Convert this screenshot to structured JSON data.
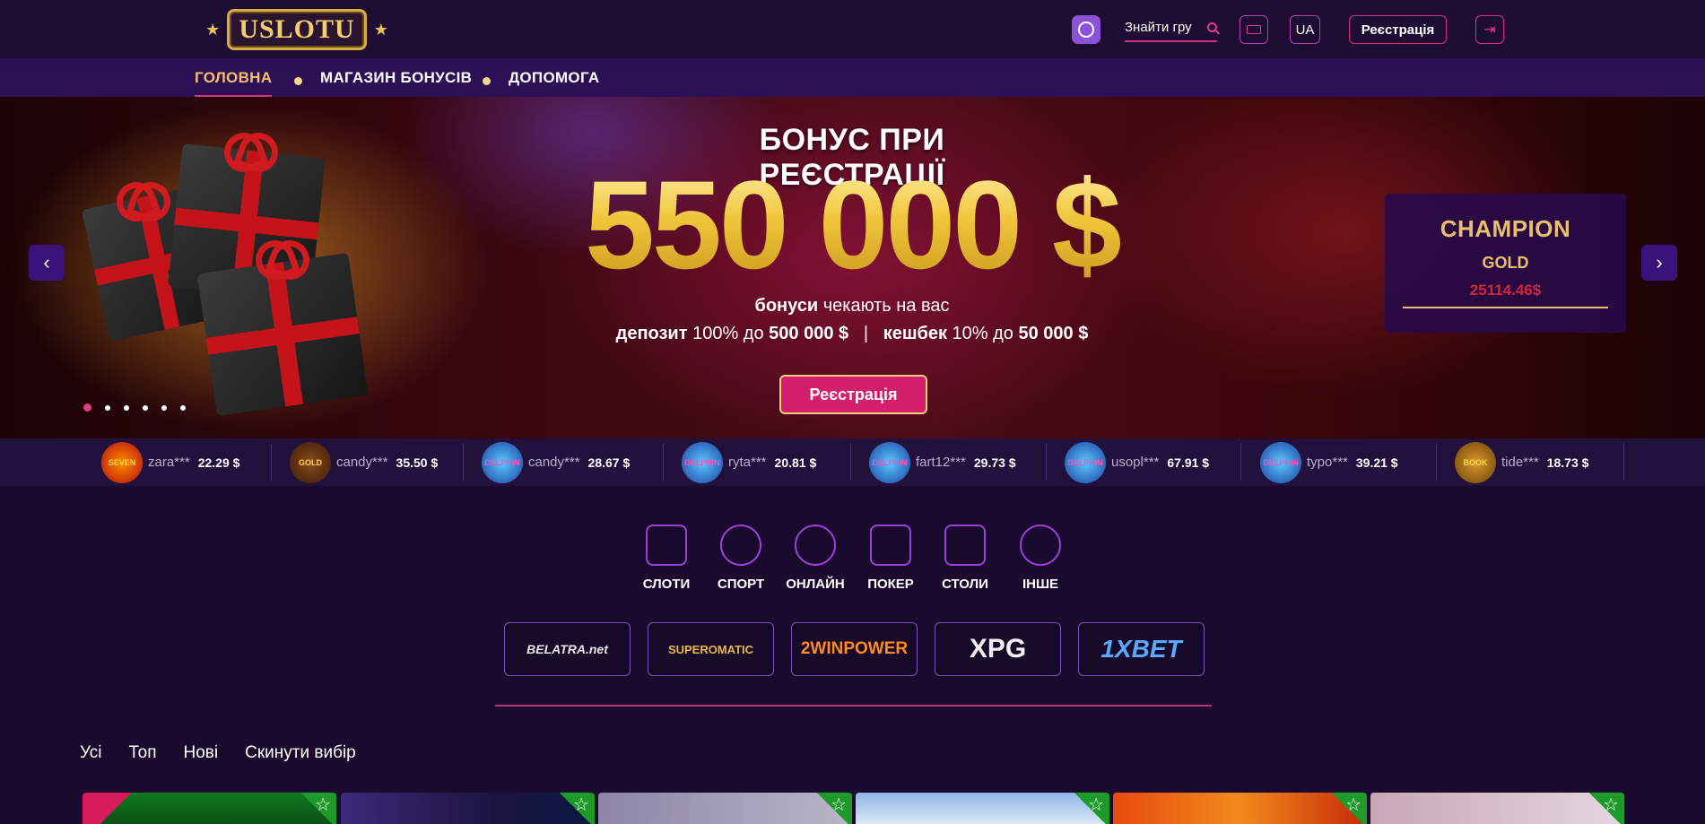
{
  "header": {
    "logo_text": "SLOT",
    "search_label": "Знайти гру",
    "lang": "UA",
    "register_label": "Реєстрація"
  },
  "nav": {
    "items": [
      "ГОЛОВНА",
      "МАГАЗИН БОНУСІВ",
      "ДОПОМОГА"
    ]
  },
  "hero": {
    "title": "БОНУС ПРИ РЕЄСТРАЦІЇ",
    "amount": "550 000 $",
    "line1_bold": "бонуси",
    "line1_rest": " чекають на вас",
    "deposit_bold": "депозит",
    "deposit_mid": " 100% до ",
    "deposit_amount": "500 000 $",
    "separator": "|",
    "cashback_bold": "кешбек",
    "cashback_mid": " 10% до ",
    "cashback_amount": "50 000 $",
    "register_button": "Реєстрація",
    "slides_total": 6,
    "active_slide": 1
  },
  "champion": {
    "title": "CHAMPION",
    "level": "GOLD",
    "amount": "25114.46$",
    "progress": 1.0
  },
  "winners": [
    {
      "name": "zara***",
      "amount": "22.29 $",
      "game_label": "SEVEN"
    },
    {
      "name": "candy***",
      "amount": "35.50 $",
      "game_label": "GOLD"
    },
    {
      "name": "candy***",
      "amount": "28.67 $",
      "game_label": "DELPHIN"
    },
    {
      "name": "ryta***",
      "amount": "20.81 $",
      "game_label": "DELPHIN"
    },
    {
      "name": "fart12***",
      "amount": "29.73 $",
      "game_label": "DELPHIN"
    },
    {
      "name": "usopl***",
      "amount": "67.91 $",
      "game_label": "DELPHIN"
    },
    {
      "name": "typo***",
      "amount": "39.21 $",
      "game_label": "DELPHIN"
    },
    {
      "name": "tide***",
      "amount": "18.73 $",
      "game_label": "BOOK"
    }
  ],
  "categories": [
    "СЛОТИ",
    "СПОРТ",
    "ОНЛАЙН",
    "ПОКЕР",
    "СТОЛИ",
    "ІНШЕ"
  ],
  "providers": [
    "BELATRA.net",
    "SUPEROMATIC",
    "2WINPOWER",
    "XPG",
    "1XBET"
  ],
  "filters": [
    "Усі",
    "Топ",
    "Нові",
    "Скинути вибір"
  ],
  "colors": {
    "background": "#1a0b2e",
    "accent_pink": "#d31f6d",
    "gold": "#e8bf6f",
    "nav_bar": "#2d0f56",
    "favorite_green": "#1d9a2a"
  }
}
